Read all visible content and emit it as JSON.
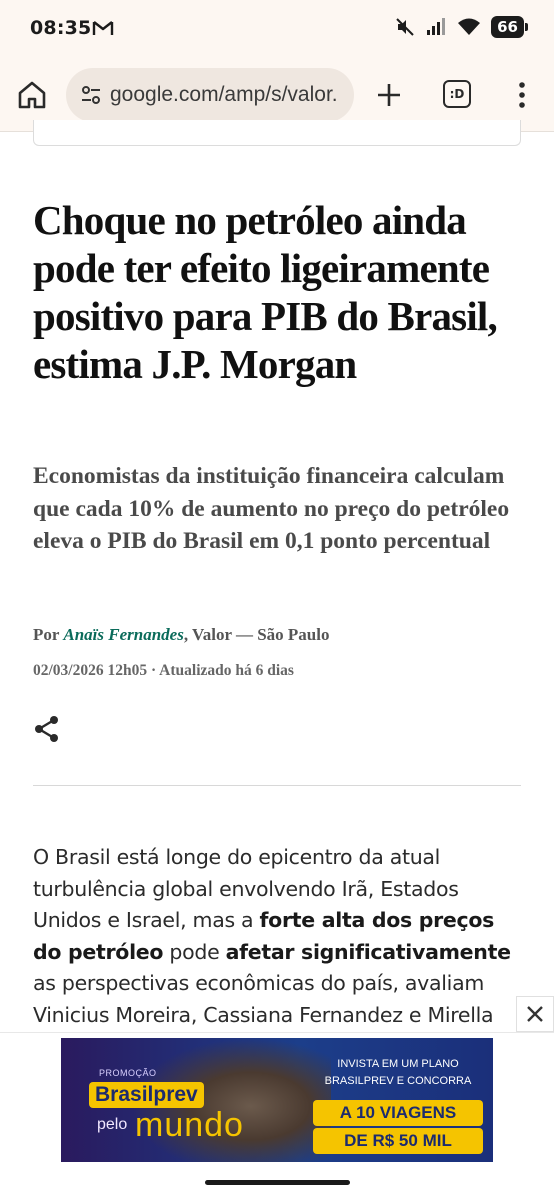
{
  "status_bar": {
    "time": "08:35",
    "battery": "66"
  },
  "browser": {
    "url": "google.com/amp/s/valor.",
    "tabs_label": ":D"
  },
  "article": {
    "headline": "Choque no petróleo ainda pode ter efeito ligeiramente positivo para PIB do Brasil, estima J.P. Morgan",
    "subheadline": "Economistas da instituição financeira calculam que cada 10% de aumento no preço do petróleo eleva o PIB do Brasil em 0,1 ponto percentual",
    "byline_prefix": "Por",
    "author": "Anaïs Fernandes",
    "byline_suffix": ", Valor — São Paulo",
    "date": "02/03/2026 12h05 · Atualizado há 6 dias",
    "body": {
      "p1": "O Brasil está longe do epicentro da atual turbulência global envolvendo Irã, Estados Unidos e Israel, mas a ",
      "b1": "forte alta dos preços do petróleo",
      "p2": " pode ",
      "b2": "afetar significativamente",
      "p3": " as perspectivas econômicas do país, avaliam Vinicius Moreira, Cassiana Fernandez e Mirella"
    }
  },
  "ad": {
    "promo": "PROMOÇÃO",
    "brand": "Brasilprev",
    "pelo": "pelo",
    "mundo": "mundo",
    "invista": "INVISTA EM UM PLANO BRASILPREV E CONCORRA",
    "prize1": "A 10 VIAGENS",
    "prize2": "DE R$ 50 MIL"
  }
}
